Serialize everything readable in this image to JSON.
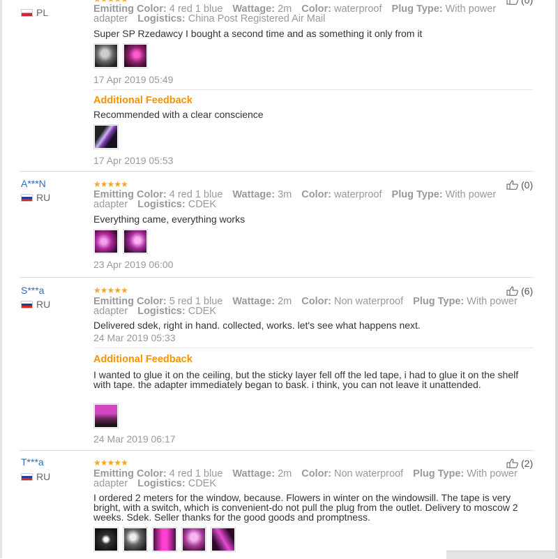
{
  "reviews": [
    {
      "buyer": "",
      "country": "PL",
      "flag": "pl",
      "helpful": "(0)",
      "attrs": [
        {
          "label": "Emitting Color:",
          "value": "4 red 1 blue"
        },
        {
          "label": "Wattage:",
          "value": "2m"
        },
        {
          "label": "Color:",
          "value": "waterproof"
        },
        {
          "label": "Plug Type:",
          "value": "With power adapter"
        },
        {
          "label": "Logistics:",
          "value": "China Post Registered Air Mail"
        }
      ],
      "text": "Super SP Rzedawcy I bought a second time and as something it only from it",
      "date": "17 Apr 2019 05:49",
      "additional": {
        "title": "Additional Feedback",
        "text": "Recommended with a clear conscience",
        "date": "17 Apr 2019 05:53"
      }
    },
    {
      "buyer": "A***N",
      "country": "RU",
      "flag": "ru",
      "helpful": "(0)",
      "attrs": [
        {
          "label": "Emitting Color:",
          "value": "4 red 1 blue"
        },
        {
          "label": "Wattage:",
          "value": "3m"
        },
        {
          "label": "Color:",
          "value": "waterproof"
        },
        {
          "label": "Plug Type:",
          "value": "With power adapter"
        },
        {
          "label": "Logistics:",
          "value": "CDEK"
        }
      ],
      "text": "Everything came, everything works",
      "date": "23 Apr 2019 06:00"
    },
    {
      "buyer": "S***a",
      "country": "RU",
      "flag": "ru",
      "helpful": "(6)",
      "attrs": [
        {
          "label": "Emitting Color:",
          "value": "5 red 1 blue"
        },
        {
          "label": "Wattage:",
          "value": "2m"
        },
        {
          "label": "Color:",
          "value": "Non waterproof"
        },
        {
          "label": "Plug Type:",
          "value": "With power adapter"
        },
        {
          "label": "Logistics:",
          "value": "CDEK"
        }
      ],
      "text": "Delivered sdek, right in hand. collected, works. let's see what happens next.",
      "date": "24 Mar 2019 05:33",
      "additional": {
        "title": "Additional Feedback",
        "text": "I wanted to glue it on the ceiling, but the sticky layer fell off the led tape, i had to glue it on the shelf with tape. the adapter immediately began to bask. i think, you can not leave it unattended.",
        "date": "24 Mar 2019 06:17"
      }
    },
    {
      "buyer": "T***a",
      "country": "RU",
      "flag": "ru",
      "helpful": "(2)",
      "attrs": [
        {
          "label": "Emitting Color:",
          "value": "4 red 1 blue"
        },
        {
          "label": "Wattage:",
          "value": "2m"
        },
        {
          "label": "Color:",
          "value": "Non waterproof"
        },
        {
          "label": "Plug Type:",
          "value": "With power adapter"
        },
        {
          "label": "Logistics:",
          "value": "CDEK"
        }
      ],
      "text": "I ordered 2 meters for the window, because. Flowers in winter on the windowsill. The tape is very bright, with a switch, which is convenient-do not pull the plug from the outlet. Delivery to moscow 2 weeks. Sdek. Seller thanks for the good goods and promptness."
    }
  ],
  "colors": {
    "star": "#f5a623",
    "buyer_link": "#2a6ebb",
    "additional_title": "#f59300",
    "muted_text": "#999999"
  },
  "icons": {
    "rating": "star-icon",
    "helpful": "thumbs-up-icon",
    "country": "flag-icon"
  }
}
